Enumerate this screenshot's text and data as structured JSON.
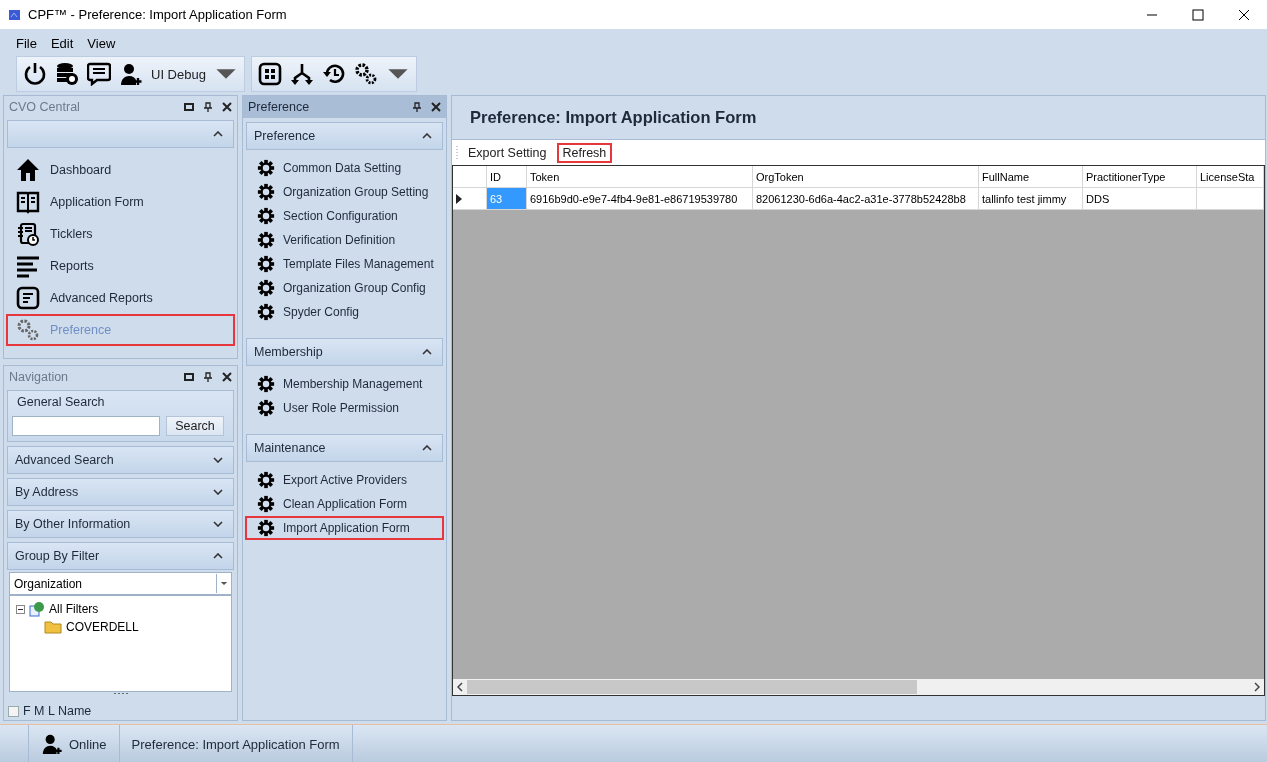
{
  "window": {
    "title": "CPF™  -  Preference: Import Application Form"
  },
  "menu": [
    "File",
    "Edit",
    "View"
  ],
  "toolbar": {
    "debug_label": "UI Debug"
  },
  "cvo_central": {
    "title": "CVO Central",
    "items": [
      {
        "label": "Dashboard",
        "kind": "home",
        "selected": false,
        "highlighted": false
      },
      {
        "label": "Application Form",
        "kind": "book",
        "selected": false,
        "highlighted": false
      },
      {
        "label": "Ticklers",
        "kind": "tickler",
        "selected": false,
        "highlighted": false
      },
      {
        "label": "Reports",
        "kind": "lines",
        "selected": false,
        "highlighted": false
      },
      {
        "label": "Advanced Reports",
        "kind": "doc",
        "selected": false,
        "highlighted": false
      },
      {
        "label": "Preference",
        "kind": "gears",
        "selected": true,
        "highlighted": true
      }
    ]
  },
  "navigation": {
    "title": "Navigation",
    "general_search": {
      "title": "General Search",
      "button": "Search"
    },
    "sections": [
      {
        "label": "Advanced Search",
        "expanded": false
      },
      {
        "label": "By Address",
        "expanded": false
      },
      {
        "label": "By Other Information",
        "expanded": false
      },
      {
        "label": "Group By Filter",
        "expanded": true
      }
    ],
    "filter_combo": {
      "value": "Organization"
    },
    "tree": [
      {
        "label": "All Filters",
        "expanded": true,
        "children": [
          {
            "label": "COVERDELL"
          }
        ]
      }
    ],
    "fml_checkbox": {
      "label": "F M L Name",
      "checked": false
    }
  },
  "preference_panel": {
    "title": "Preference",
    "groups": [
      {
        "title": "Preference",
        "expanded": true,
        "items": [
          {
            "label": "Common Data Setting",
            "highlighted": false
          },
          {
            "label": "Organization Group Setting",
            "highlighted": false
          },
          {
            "label": "Section Configuration",
            "highlighted": false
          },
          {
            "label": "Verification Definition",
            "highlighted": false
          },
          {
            "label": "Template Files Management",
            "highlighted": false
          },
          {
            "label": "Organization Group Config",
            "highlighted": false
          },
          {
            "label": "Spyder Config",
            "highlighted": false
          }
        ]
      },
      {
        "title": "Membership",
        "expanded": true,
        "items": [
          {
            "label": "Membership Management",
            "highlighted": false
          },
          {
            "label": "User Role Permission",
            "highlighted": false
          }
        ]
      },
      {
        "title": "Maintenance",
        "expanded": true,
        "items": [
          {
            "label": "Export Active Providers",
            "highlighted": false
          },
          {
            "label": "Clean Application Form",
            "highlighted": false
          },
          {
            "label": "Import Application Form",
            "highlighted": true
          }
        ]
      }
    ]
  },
  "main": {
    "title": "Preference: Import Application Form",
    "actions": [
      {
        "label": "Export Setting",
        "highlighted": false
      },
      {
        "label": "Refresh",
        "highlighted": true
      }
    ],
    "table": {
      "columns": [
        "ID",
        "Token",
        "OrgToken",
        "FullName",
        "PractitionerType",
        "LicenseSta"
      ],
      "rows": [
        {
          "current": true,
          "cells": [
            "63",
            "6916b9d0-e9e7-4fb4-9e81-e86719539780",
            "82061230-6d6a-4ac2-a31e-3778b52428b8",
            "tallinfo test jimmy",
            "DDS"
          ]
        }
      ]
    }
  },
  "status_bar": {
    "online": "Online",
    "page": "Preference: Import Application Form"
  }
}
